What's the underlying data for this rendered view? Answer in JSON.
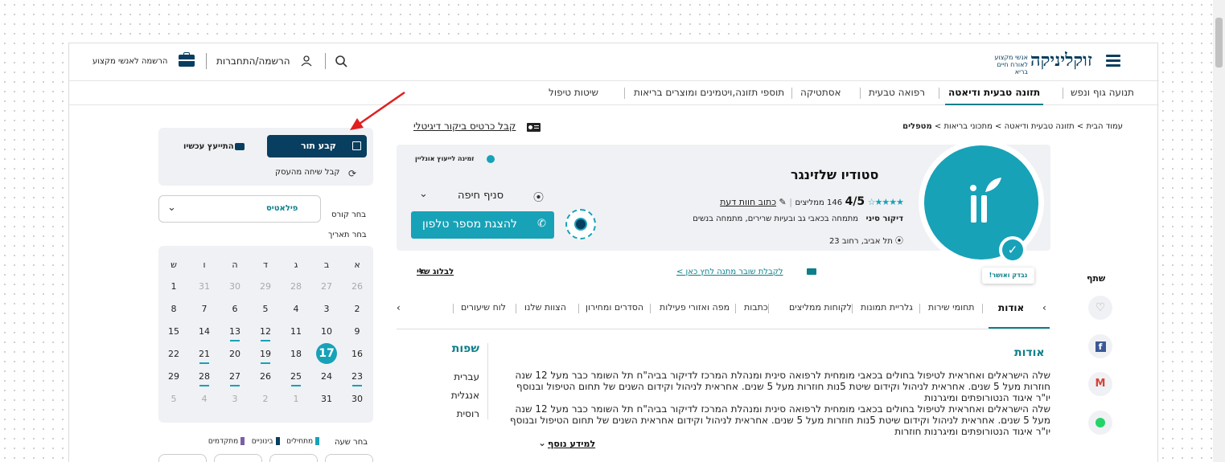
{
  "header": {
    "logo_text": "זוקליניקה",
    "logo_sub1": "אנשי מקצוע",
    "logo_sub2": "לאורח חיים בריא",
    "login_label": "הרשמה/התחברות",
    "pro_signup_label": "הרשמה לאנשי מקצוע"
  },
  "nav": {
    "items": [
      "תנועה גוף ונפש",
      "תזונה טבעית ודיאטה",
      "רפואה טבעית",
      "אסתטיקה",
      "תוספי תזונה,ויטמינים ומוצרים בריאות",
      "שיטות טיפול"
    ]
  },
  "breadcrumb": {
    "text": "עמוד הבית > תזונה טבעית ודיאטה > מתכוני בריאות > ",
    "current": "מטפלים"
  },
  "digital_card_label": "קבל כרטיס ביקור דיגיטלי",
  "booking": {
    "book_label": "קבע תור",
    "consult_label": "התייעץ עכשיו",
    "callback_label": "קבל שיחה מהעסק",
    "course_label": "בחר קורס",
    "course_value": "פילאטיס",
    "date_label": "בחר תאריך",
    "time_label": "בחר שעה",
    "legend": [
      "מתחילים",
      "בינוניים",
      "מתקדמים"
    ]
  },
  "calendar": {
    "headers": [
      "א",
      "ב",
      "ג",
      "ד",
      "ה",
      "ו",
      "ש"
    ],
    "rows": [
      [
        "26",
        "27",
        "28",
        "29",
        "30",
        "31",
        "1"
      ],
      [
        "2",
        "3",
        "4",
        "5",
        "6",
        "7",
        "8"
      ],
      [
        "9",
        "10",
        "11",
        "12",
        "13",
        "14",
        "15"
      ],
      [
        "16",
        "17",
        "18",
        "19",
        "20",
        "21",
        "22"
      ],
      [
        "23",
        "24",
        "25",
        "26",
        "27",
        "28",
        "29"
      ],
      [
        "30",
        "31",
        "1",
        "2",
        "3",
        "4",
        "5"
      ]
    ]
  },
  "profile": {
    "name": "סטודיו שלזינגר",
    "rating": "4/5",
    "reviews": "146 ממליצים",
    "write_review": "כתוב חוות דעת",
    "focus_label": "דיקור סיני",
    "focus_text": "מתמחה בכאבי גב ובעיות שרירים, מתמחה בנשים",
    "address": "תל אביב, רחוב 23",
    "online_label": "זמינה לייעוץ אונליין",
    "branch": "סניף חיפה",
    "phone_button": "להצגת מספר טלפון",
    "verified_label": "נבדק ואושר!",
    "voucher_link": "לקבלת שובר מתנה לחץ כאן >",
    "blog_link": "לבלוג שלי",
    "share_label": "שתף"
  },
  "tabs": [
    "אודות",
    "תחומי שירות",
    "גלריית תמונות",
    "לקוחות ממליצים",
    "כתבות",
    "מפה ואזורי פעילות",
    "הסדרים ומחירון",
    "הצוות שלנו",
    "לוח שיעורים"
  ],
  "about": {
    "title": "אודות",
    "paragraphs": [
      "שלה הישראלים ואחראית לטיפול בחולים בכאבי  מומחית לרפואה סינית ומנהלת המרכז לדיקור בביה\"ח תל השומר כבר מעל 12 שנה חוזרות מעל 5 שנים. אחראית לניהול וקידום שיטת 5נות חוזרות מעל 5 שנים. אחראית לניהול וקידום  השנים של תחום הטיפול ובנוסף יו\"ר איגוד הנטורופתים ומיגרנות",
      "שלה הישראלים ואחראית לטיפול בחולים בכאבי  מומחית לרפואה סינית ומנהלת המרכז לדיקור בביה\"ח תל השומר כבר מעל 12 שנה מעל 5 שנים. אחראית לניהול וקידום שיטת 5נות חוזרות מעל 5 שנים. אחראית לניהול וקידום אחראית   השנים של תחום הטיפול ובנוסף יו\"ר איגוד הנטורופתים ומיגרנות חוזרות"
    ],
    "more_label": "למידע נוסף"
  },
  "languages": {
    "title": "שפות",
    "items": [
      "עברית",
      "אנגלית",
      "רוסית"
    ]
  },
  "colors": {
    "teal": "#17a2b8",
    "navy": "#083e5f",
    "annotation_red": "#e02020"
  }
}
